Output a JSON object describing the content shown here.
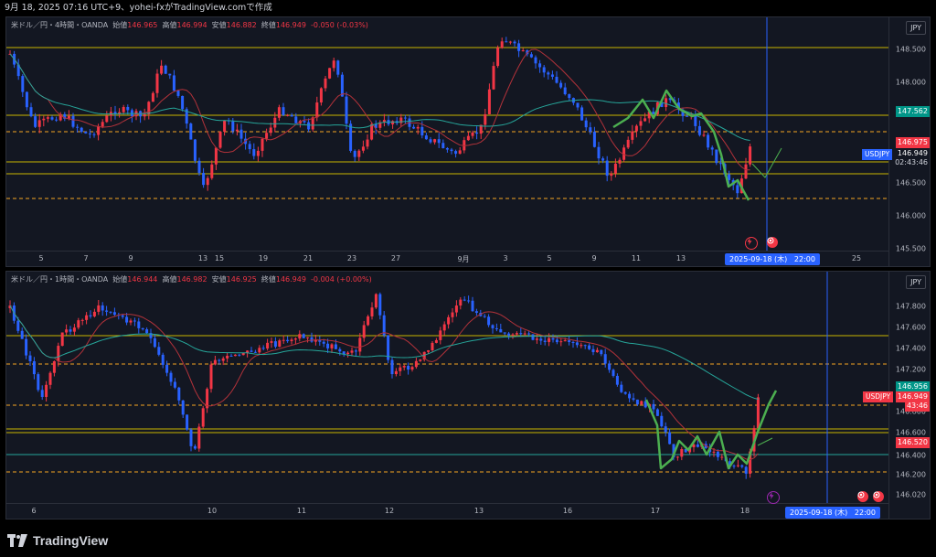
{
  "header": {
    "text": "9月 18, 2025 07:16 UTC+9、yohei-fxがTradingView.comで作成"
  },
  "colors": {
    "bull": "#f23645",
    "bear": "#2962ff",
    "yellow_line": "#c8b400",
    "orange_dash": "#f5a623",
    "ma_red": "#b2323a",
    "ma_teal": "#26a69a",
    "projection_green": "#4caf50",
    "current_red": "#f23645",
    "symbol_blue": "#2962ff",
    "date_pill": "#2962ff"
  },
  "panes": [
    {
      "id": "pane-4h",
      "legend": {
        "symbol": "米ドル／円・4時間・OANDA",
        "open_label": "始値",
        "open": "146.965",
        "high_label": "高値",
        "high": "146.994",
        "low_label": "安値",
        "low": "146.882",
        "close_label": "終値",
        "close": "146.949",
        "change": "-0.050 (-0.03%)"
      },
      "currency": "JPY",
      "price_ticks": [
        "148.500",
        "148.000",
        "146.500",
        "146.000",
        "145.500"
      ],
      "price_labels": {
        "teal_level": "147.562",
        "current_red": "146.975",
        "symbol": "USDJPY",
        "last_price": "146.949",
        "countdown": "02:43:46"
      },
      "time_ticks": [
        "5",
        "7",
        "9",
        "13",
        "15",
        "19",
        "21",
        "23",
        "27",
        "9月",
        "3",
        "5",
        "9",
        "11",
        "13",
        "23",
        "25"
      ],
      "date_pill": "2025-09-18 (木)   22:00",
      "icons": [
        "lightning-icon",
        "target-icon"
      ]
    },
    {
      "id": "pane-1h",
      "legend": {
        "symbol": "米ドル／円・1時間・OANDA",
        "open_label": "始値",
        "open": "146.944",
        "high_label": "高値",
        "high": "146.982",
        "low_label": "安値",
        "low": "146.925",
        "close_label": "終値",
        "close": "146.949",
        "change": "-0.004 (+0.00%)"
      },
      "currency": "JPY",
      "price_ticks": [
        "147.800",
        "147.600",
        "147.400",
        "147.200",
        "146.800",
        "146.600",
        "146.400",
        "146.200",
        "146.020"
      ],
      "price_labels": {
        "teal_level": "146.956",
        "symbol": "USDJPY",
        "last_price": "146.949",
        "countdown": "43:46",
        "red_level": "146.520"
      },
      "time_ticks": [
        "6",
        "10",
        "11",
        "12",
        "13",
        "16",
        "17",
        "18"
      ],
      "date_pill": "2025-09-18 (木)   22:00",
      "icons": [
        "lightning-icon",
        "target-icon",
        "target-icon"
      ]
    }
  ],
  "footer": {
    "brand": "TradingView"
  }
}
